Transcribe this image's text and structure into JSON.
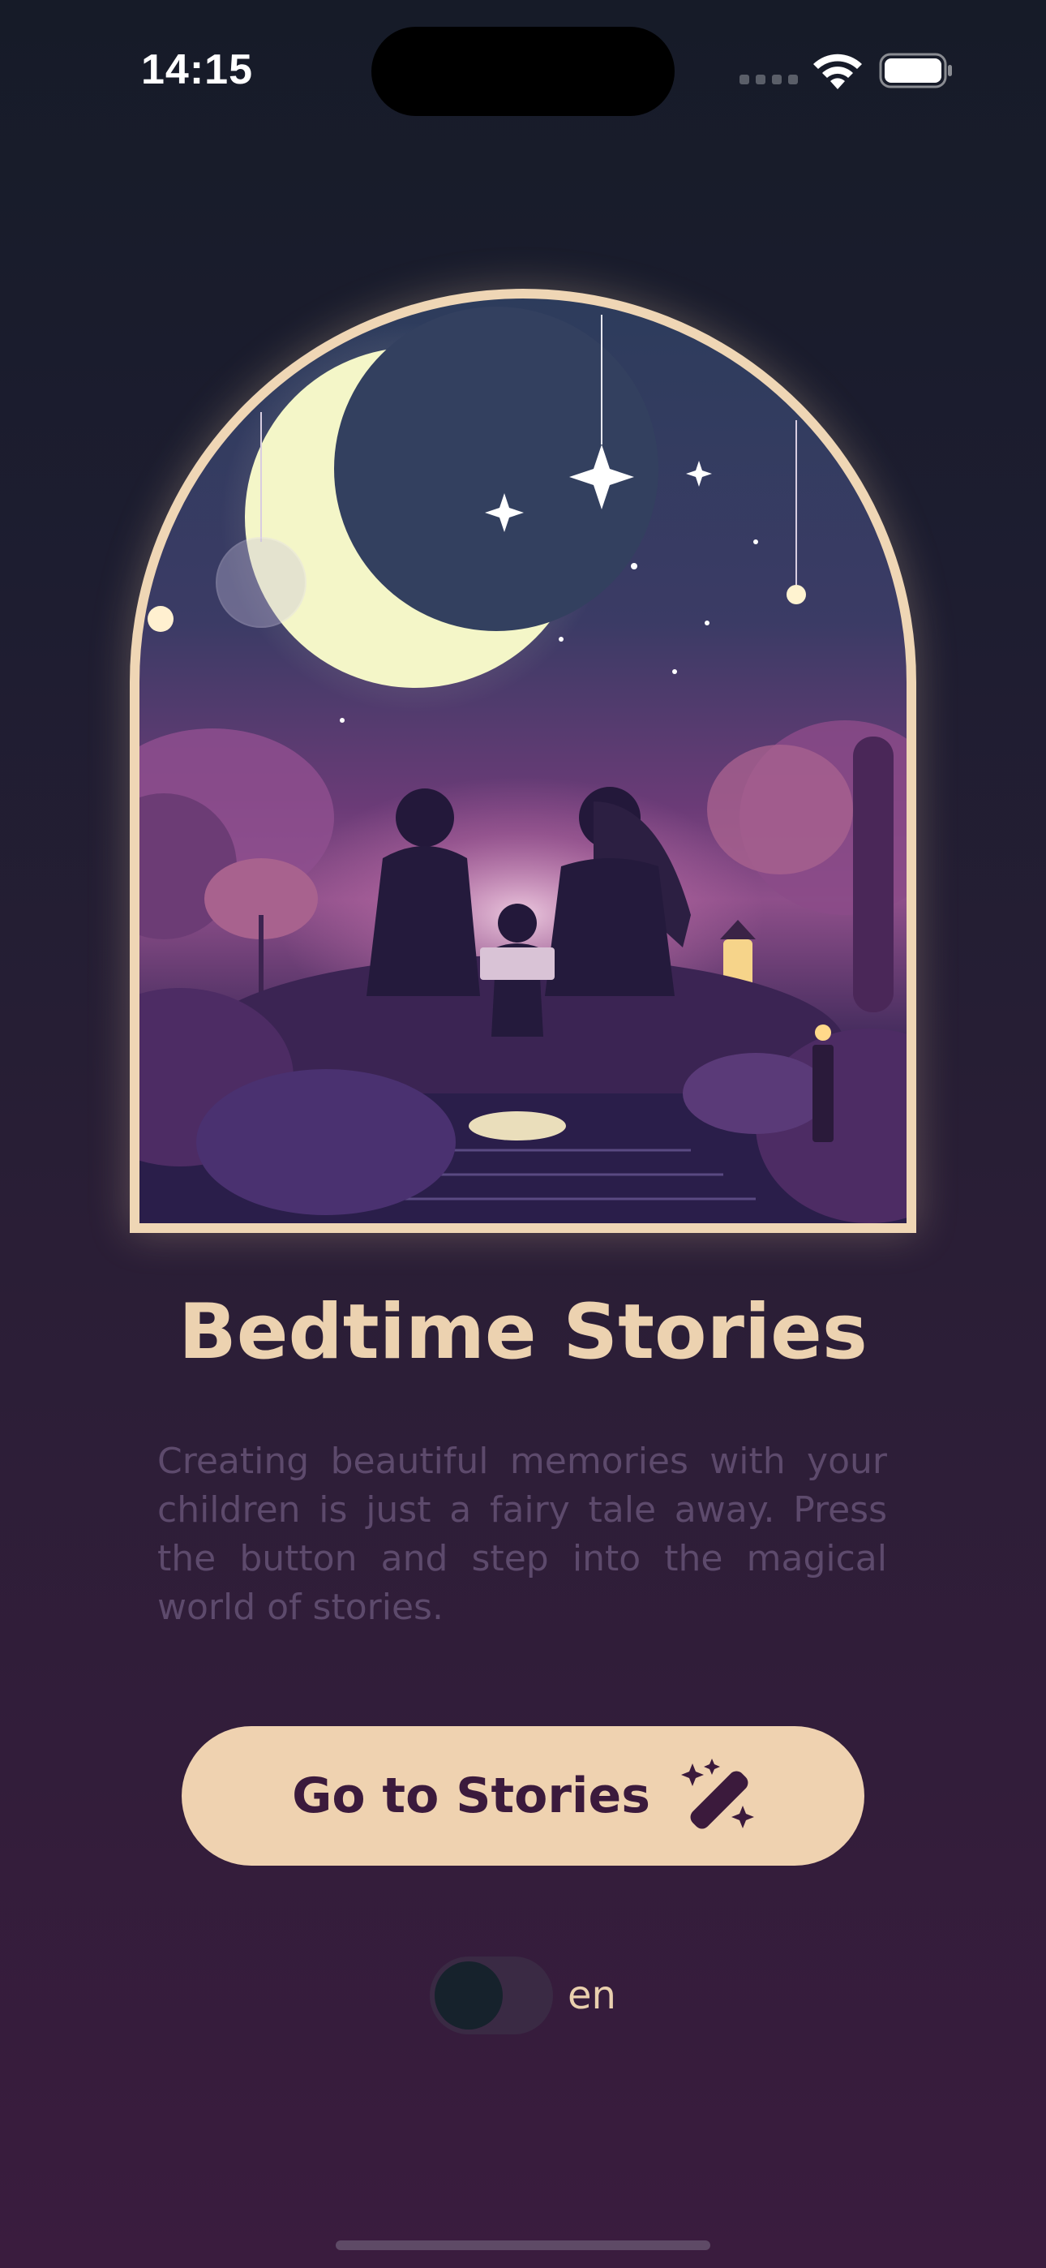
{
  "status_bar": {
    "time": "14:15",
    "signal_icon": "signal-dots-icon",
    "wifi_icon": "wifi-icon",
    "battery_icon": "battery-icon"
  },
  "hero": {
    "illustration": "family-bedtime-story-under-moon-illustration"
  },
  "title": "Bedtime Stories",
  "description": "Creating beautiful memories with your children is just a fairy tale away. Press the button and step into the magical world of stories.",
  "cta": {
    "label": "Go to Stories",
    "icon": "magic-wand-icon"
  },
  "language_toggle": {
    "label": "en",
    "on": false
  },
  "colors": {
    "accent": "#efd2b0",
    "accent_text": "#3b1a3c",
    "background_top": "#161b28",
    "background_bottom": "#3a1c3e",
    "muted_text": "#5d4a6c"
  }
}
